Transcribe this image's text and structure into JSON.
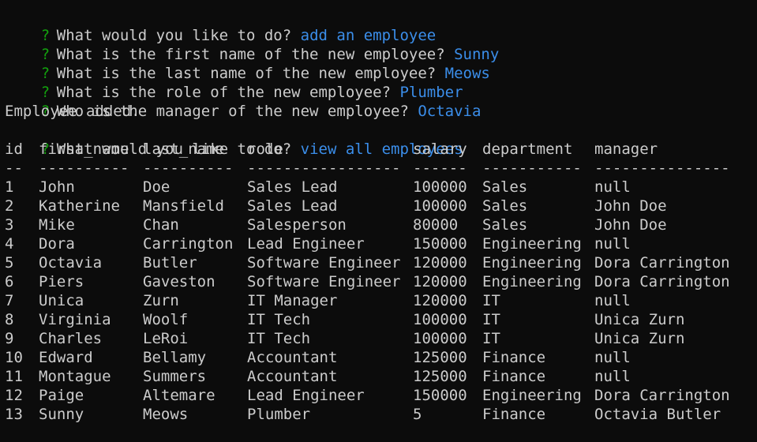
{
  "prompt_marker": "?",
  "session": [
    {
      "question": "What would you like to do?",
      "answer": "add an employee"
    },
    {
      "question": "What is the first name of the new employee?",
      "answer": "Sunny"
    },
    {
      "question": "What is the last name of the new employee?",
      "answer": "Meows"
    },
    {
      "question": "What is the role of the new employee?",
      "answer": "Plumber"
    },
    {
      "question": "Who is the manager of the new employee?",
      "answer": "Octavia"
    }
  ],
  "status_message": "Employee added.",
  "second_prompt": {
    "question": "What would you like to do?",
    "answer": "view all employees"
  },
  "table": {
    "headers": {
      "id": "id",
      "first_name": "first_name",
      "last_name": "last_name",
      "role": "role",
      "salary": "salary",
      "department": "department",
      "manager": "manager"
    },
    "separators": {
      "id": "--",
      "first_name": "----------",
      "last_name": "----------",
      "role": "-----------------",
      "salary": "------",
      "department": "-----------",
      "manager": "---------------"
    },
    "rows": [
      {
        "id": "1",
        "first_name": "John",
        "last_name": "Doe",
        "role": "Sales Lead",
        "salary": "100000",
        "department": "Sales",
        "manager": "null"
      },
      {
        "id": "2",
        "first_name": "Katherine",
        "last_name": "Mansfield",
        "role": "Sales Lead",
        "salary": "100000",
        "department": "Sales",
        "manager": "John Doe"
      },
      {
        "id": "3",
        "first_name": "Mike",
        "last_name": "Chan",
        "role": "Salesperson",
        "salary": "80000",
        "department": "Sales",
        "manager": "John Doe"
      },
      {
        "id": "4",
        "first_name": "Dora",
        "last_name": "Carrington",
        "role": "Lead Engineer",
        "salary": "150000",
        "department": "Engineering",
        "manager": "null"
      },
      {
        "id": "5",
        "first_name": "Octavia",
        "last_name": "Butler",
        "role": "Software Engineer",
        "salary": "120000",
        "department": "Engineering",
        "manager": "Dora Carrington"
      },
      {
        "id": "6",
        "first_name": "Piers",
        "last_name": "Gaveston",
        "role": "Software Engineer",
        "salary": "120000",
        "department": "Engineering",
        "manager": "Dora Carrington"
      },
      {
        "id": "7",
        "first_name": "Unica",
        "last_name": "Zurn",
        "role": "IT Manager",
        "salary": "120000",
        "department": "IT",
        "manager": "null"
      },
      {
        "id": "8",
        "first_name": "Virginia",
        "last_name": "Woolf",
        "role": "IT Tech",
        "salary": "100000",
        "department": "IT",
        "manager": "Unica Zurn"
      },
      {
        "id": "9",
        "first_name": "Charles",
        "last_name": "LeRoi",
        "role": "IT Tech",
        "salary": "100000",
        "department": "IT",
        "manager": "Unica Zurn"
      },
      {
        "id": "10",
        "first_name": "Edward",
        "last_name": "Bellamy",
        "role": "Accountant",
        "salary": "125000",
        "department": "Finance",
        "manager": "null"
      },
      {
        "id": "11",
        "first_name": "Montague",
        "last_name": "Summers",
        "role": "Accountant",
        "salary": "125000",
        "department": "Finance",
        "manager": "null"
      },
      {
        "id": "12",
        "first_name": "Paige",
        "last_name": "Altemare",
        "role": "Lead Engineer",
        "salary": "150000",
        "department": "Engineering",
        "manager": "Dora Carrington"
      },
      {
        "id": "13",
        "first_name": "Sunny",
        "last_name": "Meows",
        "role": "Plumber",
        "salary": "5",
        "department": "Finance",
        "manager": "Octavia Butler"
      }
    ]
  },
  "colors": {
    "background": "#0c0c0c",
    "text": "#cccccc",
    "prompt_marker": "#13a10e",
    "answer": "#3b8eea"
  }
}
